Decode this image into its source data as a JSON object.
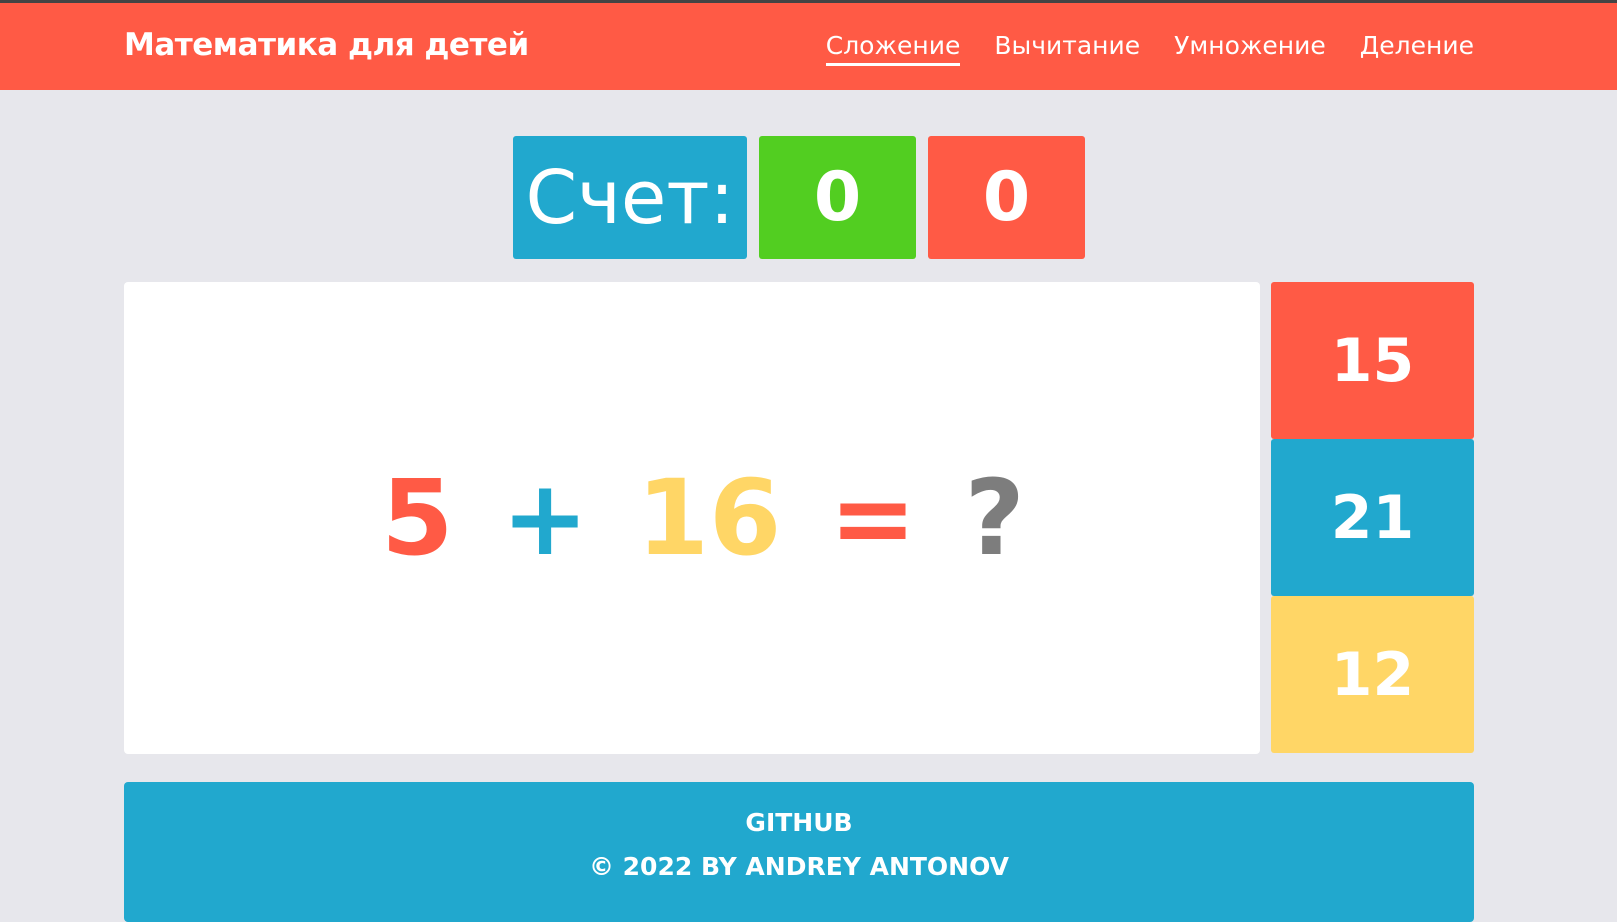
{
  "header": {
    "brand": "Математика для детей",
    "nav": [
      {
        "label": "Сложение",
        "active": true
      },
      {
        "label": "Вычитание",
        "active": false
      },
      {
        "label": "Умножение",
        "active": false
      },
      {
        "label": "Деление",
        "active": false
      }
    ]
  },
  "score": {
    "label": "Счет:",
    "correct": "0",
    "wrong": "0"
  },
  "problem": {
    "first": "5",
    "operator": "+",
    "second": "16",
    "equals": "=",
    "unknown": "?"
  },
  "answers": [
    "15",
    "21",
    "12"
  ],
  "footer": {
    "link": "GITHUB",
    "copyright": "© 2022 BY ANDREY ANTONOV"
  },
  "colors": {
    "red": "#ff5a45",
    "blue": "#21a8ce",
    "green": "#52ce21",
    "yellow": "#ffd666",
    "gray": "#7d7d7d",
    "background": "#e7e7ec"
  }
}
